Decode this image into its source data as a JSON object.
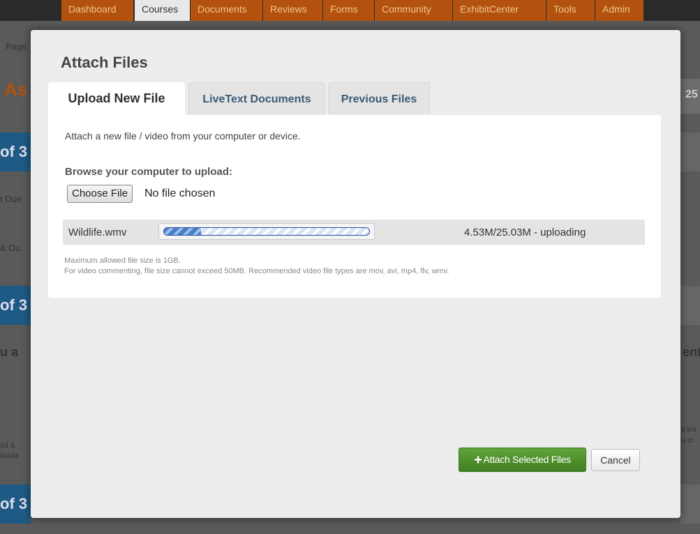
{
  "background": {
    "nav": [
      "Dashboard",
      "Courses",
      "Documents",
      "Reviews",
      "Forms",
      "Community",
      "ExhibitCenter",
      "Tools",
      "Admin"
    ],
    "active_nav": "Courses",
    "fragments": {
      "page": "Page",
      "as": "As",
      "of1": "of 3",
      "due": "t Due",
      "ou": "& Ou",
      "of2": "of 3",
      "ua": "u a",
      "sda": "sd a",
      "loada": "loada",
      "of3": "of 3",
      "right25": "25",
      "ent": "ent",
      "tra": "s tra",
      "cr": "u cr"
    }
  },
  "modal": {
    "title": "Attach Files",
    "tabs": [
      {
        "label": "Upload New File",
        "active": true
      },
      {
        "label": "LiveText Documents",
        "active": false
      },
      {
        "label": "Previous Files",
        "active": false
      }
    ],
    "intro": "Attach a new file / video from your computer or device.",
    "browse_label": "Browse your computer to upload:",
    "choose_file_label": "Choose File",
    "no_file_text": "No file chosen",
    "upload": {
      "file_name": "Wildlife.wmv",
      "progress_fraction": 0.18,
      "status": "4.53M/25.03M - uploading"
    },
    "notes": {
      "max_size": "Maximum allowed file size is 1GB.",
      "video": "For video commenting, file size cannot exceed 50MB. Recommended video file types are mov, avi, mp4, flv, wmv."
    },
    "attach_button_label": "Attach Selected Files",
    "cancel_button_label": "Cancel"
  },
  "colors": {
    "attach_green": "#4f9230",
    "nav_orange": "#b3520e",
    "progress_blue": "#4a7fc9"
  }
}
